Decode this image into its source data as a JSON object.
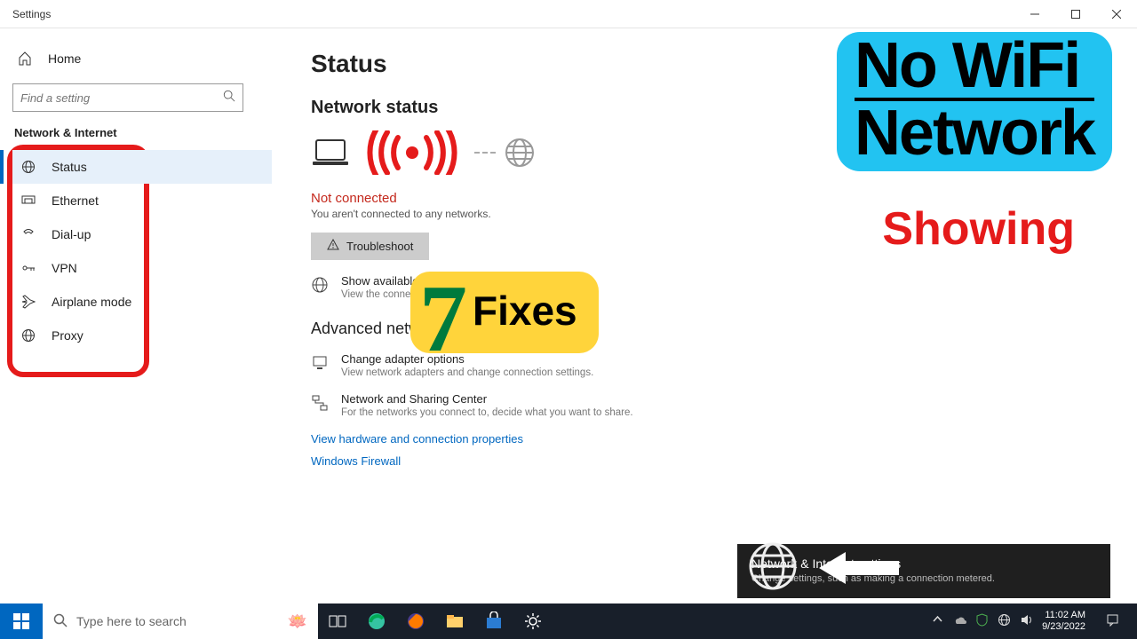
{
  "window": {
    "title": "Settings"
  },
  "sidebar": {
    "home": "Home",
    "search_placeholder": "Find a setting",
    "section": "Network & Internet",
    "items": [
      {
        "label": "Status",
        "icon": "status-icon",
        "active": true
      },
      {
        "label": "Ethernet",
        "icon": "ethernet-icon",
        "active": false
      },
      {
        "label": "Dial-up",
        "icon": "dialup-icon",
        "active": false
      },
      {
        "label": "VPN",
        "icon": "vpn-icon",
        "active": false
      },
      {
        "label": "Airplane mode",
        "icon": "airplane-icon",
        "active": false
      },
      {
        "label": "Proxy",
        "icon": "proxy-icon",
        "active": false
      }
    ]
  },
  "main": {
    "title": "Status",
    "section1": "Network status",
    "not_connected": "Not connected",
    "not_connected_sub": "You aren't connected to any networks.",
    "troubleshoot": "Troubleshoot",
    "show_networks": {
      "title": "Show available networks",
      "desc": "View the connection options around you."
    },
    "adv_heading": "Advanced network settings",
    "adapter": {
      "title": "Change adapter options",
      "desc": "View network adapters and change connection settings."
    },
    "sharing": {
      "title": "Network and Sharing Center",
      "desc": "For the networks you connect to, decide what you want to share."
    },
    "link_hw": "View hardware and connection properties",
    "link_fw": "Windows Firewall"
  },
  "overlay": {
    "badge_line1": "No WiFi",
    "badge_line2": "Network",
    "showing": "Showing",
    "seven": "7",
    "fixes": "Fixes"
  },
  "popup": {
    "title": "Network & Internet settings",
    "desc": "Change settings, such as making a connection metered."
  },
  "taskbar": {
    "search_placeholder": "Type here to search",
    "time": "11:02 AM",
    "date": "9/23/2022"
  }
}
